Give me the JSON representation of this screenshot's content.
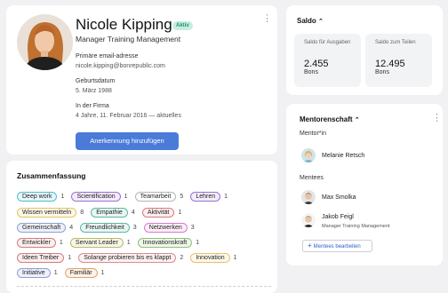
{
  "profile": {
    "name": "Nicole Kipping",
    "badge": "Aktiv",
    "title": "Manager Training Management",
    "email_label": "Primäre email-adresse",
    "email": "nicole.kipping@bonrepublic.com",
    "birth_label": "Geburtsdatum",
    "birth": "5. März 1988",
    "company_label": "In der Firma",
    "company": "4 Jahre, 11. Februar 2016 — aktuelles",
    "button": "Anerkennung hinzufügen"
  },
  "summary": {
    "title": "Zusammenfassung",
    "tags": [
      {
        "label": "Deep work",
        "count": "1",
        "color": "#4fbdd0",
        "bg": "#e8f7fa"
      },
      {
        "label": "Scientification",
        "count": "1",
        "color": "#9c6fd6",
        "bg": "#f3ecfb"
      },
      {
        "label": "Teamarbeit",
        "count": "5",
        "color": "#b4b4b4",
        "bg": "#ffffff"
      },
      {
        "label": "Lehren",
        "count": "1",
        "color": "#9c6fd6",
        "bg": "#f3ecfb"
      },
      {
        "label": "Wissen vermitteln",
        "count": "8",
        "color": "#e3c36a",
        "bg": "#fdf8e8"
      },
      {
        "label": "Empathie",
        "count": "4",
        "color": "#5ab8a4",
        "bg": "#e9f6f2"
      },
      {
        "label": "Aktivität",
        "count": "1",
        "color": "#d77b7b",
        "bg": "#fbeeee"
      },
      {
        "label": "Gemeinschaft",
        "count": "4",
        "color": "#8da0d4",
        "bg": "#eef1fa"
      },
      {
        "label": "Freundlichkeit",
        "count": "3",
        "color": "#5ab8a4",
        "bg": "#e9f6f2"
      },
      {
        "label": "Netzwerken",
        "count": "3",
        "color": "#d77bc7",
        "bg": "#fbeef8"
      },
      {
        "label": "Entwickler",
        "count": "1",
        "color": "#d77b7b",
        "bg": "#fbeeee"
      },
      {
        "label": "Servant Leader",
        "count": "1",
        "color": "#b9b96a",
        "bg": "#f7f7e6"
      },
      {
        "label": "Innovationskraft",
        "count": "1",
        "color": "#8fc07a",
        "bg": "#eff7ea"
      },
      {
        "label": "Ideen Treiber",
        "count": "1",
        "color": "#d77b7b",
        "bg": "#fbeeee"
      },
      {
        "label": "Solange probieren bis es klappt",
        "count": "2",
        "color": "#d98e8e",
        "bg": "#fcf1f1"
      },
      {
        "label": "Innovation",
        "count": "1",
        "color": "#e3c36a",
        "bg": "#fdf8e8"
      },
      {
        "label": "Initiative",
        "count": "1",
        "color": "#8da0d4",
        "bg": "#eef1fa"
      },
      {
        "label": "Familiär",
        "count": "1",
        "color": "#e0a36a",
        "bg": "#fcf2e8"
      }
    ]
  },
  "saldo": {
    "title": "Saldo",
    "boxes": [
      {
        "label": "Saldo für Ausgaben",
        "value": "2.455",
        "unit": "Bons"
      },
      {
        "label": "Saldo zum Teilen",
        "value": "12.495",
        "unit": "Bons"
      }
    ]
  },
  "mentorship": {
    "title": "Mentorenschaft",
    "mentor_label": "Mentor*in",
    "mentor": {
      "name": "Melanie Retsch"
    },
    "mentees_label": "Mentees",
    "mentees": [
      {
        "name": "Max Smolka",
        "title": ""
      },
      {
        "name": "Jakob Feigl",
        "title": "Manager Training Management"
      }
    ],
    "edit_button": "Mentees bearbeiten",
    "plus_icon": "+"
  },
  "colors": {
    "accent": "#4b7bd8",
    "badge_bg": "#c7ece0",
    "badge_fg": "#19926e"
  }
}
